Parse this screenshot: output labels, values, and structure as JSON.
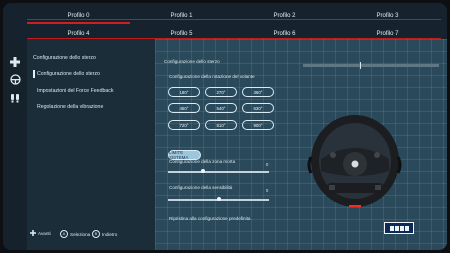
{
  "profiles": [
    {
      "label": "Profilo 0",
      "active": true
    },
    {
      "label": "Profilo 1",
      "active": false
    },
    {
      "label": "Profilo 2",
      "active": false
    },
    {
      "label": "Profilo 3",
      "active": false
    },
    {
      "label": "Profilo 4",
      "active": false
    },
    {
      "label": "Profilo 5",
      "active": false
    },
    {
      "label": "Profilo 6",
      "active": false
    },
    {
      "label": "Profilo 7",
      "active": false
    }
  ],
  "sidebar_icons": [
    "dpad-icon",
    "steering-icon",
    "pedals-icon"
  ],
  "menu": {
    "section": "Configurazione dello sterzo",
    "items": [
      {
        "label": "Configurazione dello sterzo",
        "selected": true
      },
      {
        "label": "Impostazioni del Force Feedback",
        "selected": false
      },
      {
        "label": "Regolazione della vibrazione",
        "selected": false
      }
    ]
  },
  "hints": {
    "back": "Avanti",
    "select": "Seleziona",
    "back2": "Indietro",
    "select_button": "A",
    "back_button": "B"
  },
  "main": {
    "title": "Configurazione dello sterzo",
    "rotation_label": "Configurazione della rotazione del volante",
    "rotation_options": [
      "180°",
      "270°",
      "360°",
      "450°",
      "540°",
      "630°",
      "720°",
      "810°",
      "900°"
    ],
    "selected_rotation": "LIMITE SISTEMA",
    "deadzone_label": "Configurazione della zona morta",
    "deadzone_value": "0",
    "deadzone_level": 0.35,
    "sensitivity_label": "Configurazione della sensibilità",
    "sensitivity_value": "0",
    "sensitivity_level": 0.5,
    "reset_label": "Ripristina alla configurazione predefinita",
    "wheel_position": 0.5
  },
  "brand": "HORI",
  "colors": {
    "accent": "#d21e1e",
    "panel": "#2a4a5c",
    "menu": "#1c2d3a"
  }
}
